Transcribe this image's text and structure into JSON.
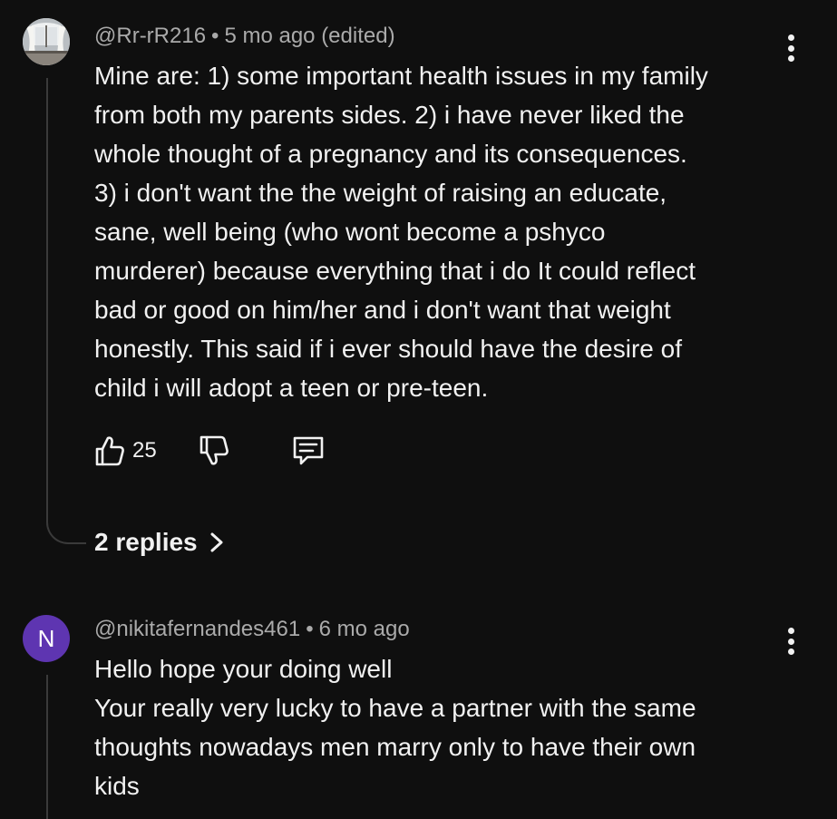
{
  "comments": [
    {
      "author": "@Rr-rR216",
      "separator": "•",
      "time": "5 mo ago (edited)",
      "text": "Mine are: 1) some important health issues in my family\nfrom both my parents sides. 2) i have never liked the\nwhole thought of a pregnancy and its consequences.\n3) i don't want the the weight of raising an educate,\nsane, well being (who wont become a pshyco\nmurderer) because everything that i do It could reflect\nbad or good on him/her and i don't want that weight\nhonestly. This said if i ever should have the desire of\nchild i will adopt a teen or pre-teen.",
      "likes": "25",
      "replies_label": "2 replies",
      "avatar_icon": "window-photo-avatar"
    },
    {
      "author": "@nikitafernandes461",
      "separator": "•",
      "time": "6 mo ago",
      "text": "Hello hope your doing well\nYour really very lucky to have a partner with the same\nthoughts nowadays men marry only to have their own\nkids",
      "avatar_initial": "N",
      "avatar_color": "#5e35b1"
    }
  ],
  "icons": {
    "like": "thumbs-up-icon",
    "dislike": "thumbs-down-icon",
    "reply": "comment-icon",
    "more": "more-vertical-icon",
    "chevron": "chevron-right-icon"
  }
}
